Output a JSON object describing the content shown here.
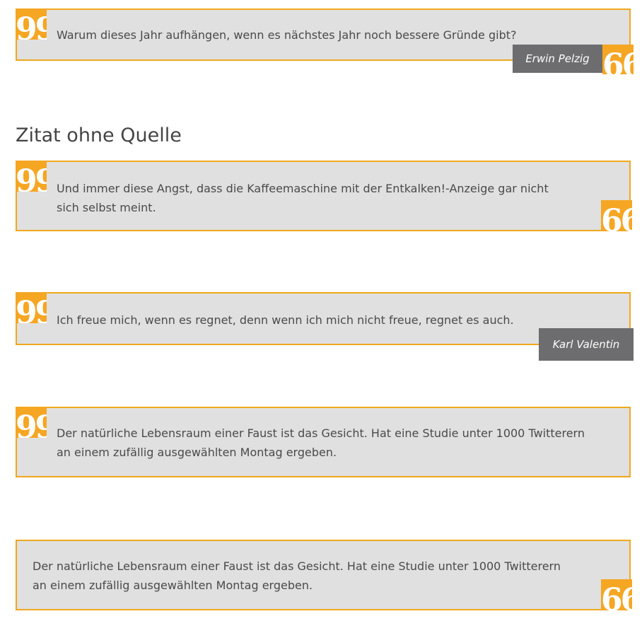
{
  "quotes": [
    {
      "text": "Warum dieses Jahr aufhängen, wenn es nächstes Jahr noch bessere Gründe gibt?",
      "source": "Erwin Pelzig"
    },
    {
      "text": "Und immer diese Angst, dass die Kaffeemaschine mit der Entkalken!-Anzeige gar nicht sich selbst meint."
    },
    {
      "text": "Ich freue mich, wenn es regnet, denn wenn ich mich nicht freue, regnet es auch.",
      "source": "Karl Valentin"
    },
    {
      "text": "Der natürliche Lebensraum einer Faust ist das Gesicht. Hat eine Studie unter 1000 Twitterern an einem zufällig ausgewählten Montag ergeben."
    },
    {
      "text": "Der natürliche Lebensraum einer Faust ist das Gesicht. Hat eine Studie unter 1000 Twitterern an einem zufällig ausgewählten Montag ergeben."
    }
  ],
  "heading": "Zitat ohne Quelle",
  "icons": {
    "open_quote": "quote-open-icon",
    "close_quote": "quote-close-icon",
    "open_glyph": "99",
    "close_glyph": "66"
  },
  "colors": {
    "accent": "#f5a623",
    "border": "#f0a81e",
    "quote_background": "#e0e0e0",
    "source_background": "#6d6d70",
    "text": "#4a4a4a"
  }
}
